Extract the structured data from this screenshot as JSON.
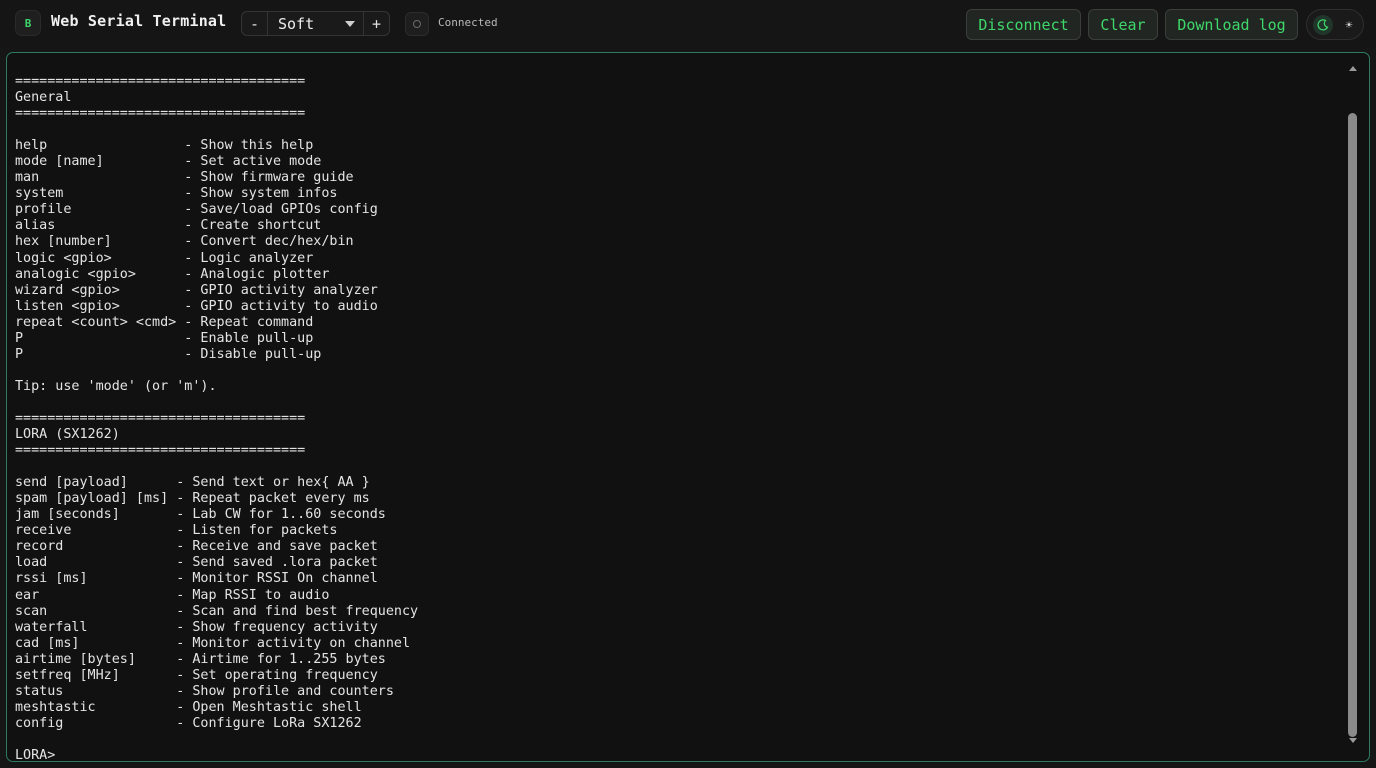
{
  "app": {
    "logo_letter": "B",
    "title": "Web Serial Terminal"
  },
  "font_control": {
    "minus": "-",
    "selected": "Soft",
    "plus": "+"
  },
  "status": {
    "text": "Connected",
    "icon": "status-circle-icon"
  },
  "actions": {
    "disconnect": "Disconnect",
    "clear": "Clear",
    "download": "Download log"
  },
  "theme": {
    "dark_icon": "moon-icon",
    "light_icon": "sun-icon",
    "light_glyph": "☀"
  },
  "colors": {
    "accent": "#3fd76a",
    "terminal_border": "#2f7a62"
  },
  "terminal": {
    "lines": [
      "====================================",
      "General",
      "====================================",
      "",
      "help                 - Show this help",
      "mode [name]          - Set active mode",
      "man                  - Show firmware guide",
      "system               - Show system infos",
      "profile              - Save/load GPIOs config",
      "alias                - Create shortcut",
      "hex [number]         - Convert dec/hex/bin",
      "logic <gpio>         - Logic analyzer",
      "analogic <gpio>      - Analogic plotter",
      "wizard <gpio>        - GPIO activity analyzer",
      "listen <gpio>        - GPIO activity to audio",
      "repeat <count> <cmd> - Repeat command",
      "P                    - Enable pull-up",
      "P                    - Disable pull-up",
      "",
      "Tip: use 'mode' (or 'm').",
      "",
      "====================================",
      "LORA (SX1262)",
      "====================================",
      "",
      "send [payload]      - Send text or hex{ AA }",
      "spam [payload] [ms] - Repeat packet every ms",
      "jam [seconds]       - Lab CW for 1..60 seconds",
      "receive             - Listen for packets",
      "record              - Receive and save packet",
      "load                - Send saved .lora packet",
      "rssi [ms]           - Monitor RSSI On channel",
      "ear                 - Map RSSI to audio",
      "scan                - Scan and find best frequency",
      "waterfall           - Show frequency activity",
      "cad [ms]            - Monitor activity on channel",
      "airtime [bytes]     - Airtime for 1..255 bytes",
      "setfreq [MHz]       - Set operating frequency",
      "status              - Show profile and counters",
      "meshtastic          - Open Meshtastic shell",
      "config              - Configure LoRa SX1262",
      "",
      "LORA>"
    ]
  }
}
